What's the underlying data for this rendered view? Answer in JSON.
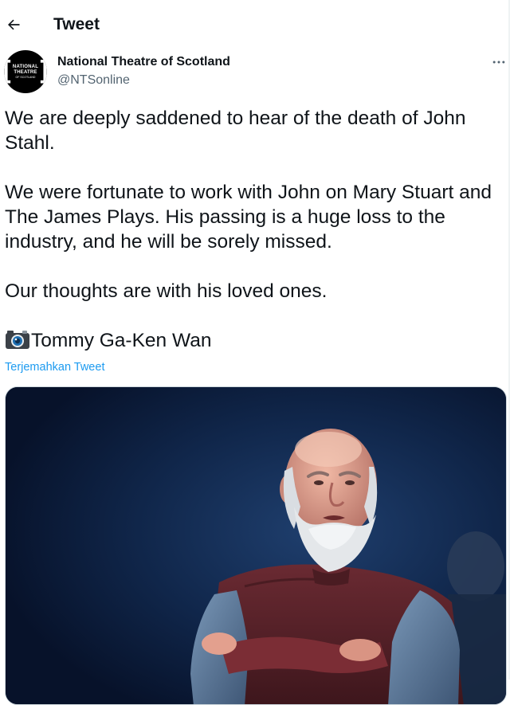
{
  "header": {
    "title": "Tweet",
    "back_icon": "arrow-left-icon"
  },
  "author": {
    "display_name": "National Theatre of Scotland",
    "handle": "@NTSonline",
    "avatar_logo": {
      "line1": "NATIONAL",
      "line2": "THEATRE",
      "line3": "OF SCOTLAND"
    }
  },
  "tweet": {
    "paragraphs": [
      "We are deeply saddened to hear of the death of John Stahl.",
      "We were fortunate to work with John on Mary Stuart and The James Plays. His passing is a huge loss to the industry, and he will be sorely missed.",
      "Our thoughts are with his loved ones."
    ],
    "credit": "Tommy Ga-Ken Wan",
    "credit_icon": "camera-emoji-icon",
    "translate_label": "Terjemahkan Tweet"
  },
  "colors": {
    "text": "#0f1419",
    "secondary": "#536471",
    "link": "#1d9bf0",
    "photo_bg": "#0c1a33"
  }
}
